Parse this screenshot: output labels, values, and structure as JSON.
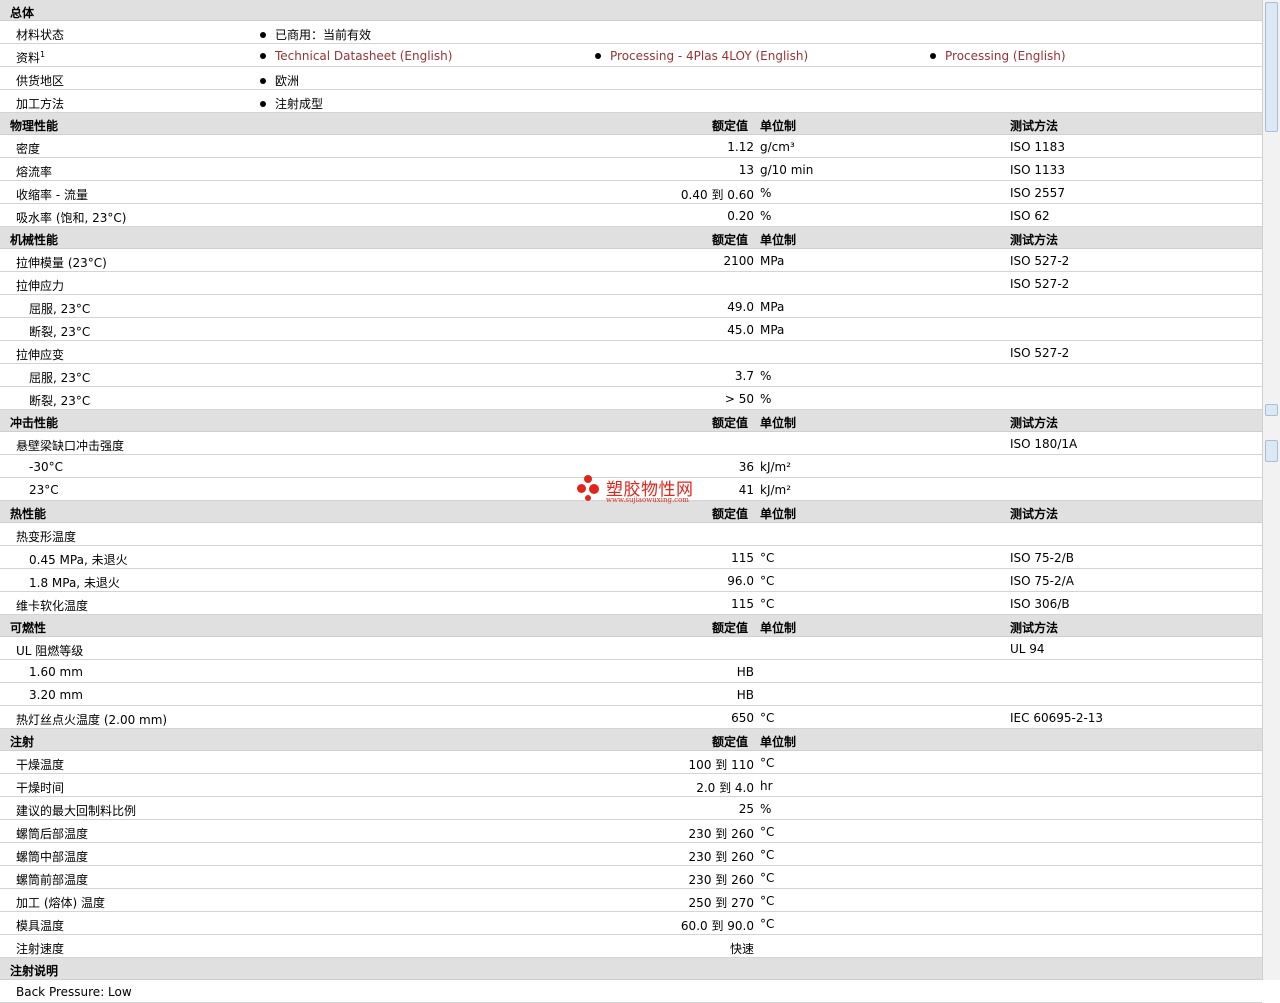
{
  "general": {
    "title": "总体",
    "status_label": "材料状态",
    "status_value": "已商用：当前有效",
    "docs_label": "资料",
    "docs_sup": "1",
    "docs": [
      "Technical Datasheet (English)",
      "Processing - 4Plas 4LOY (English)",
      "Processing (English)"
    ],
    "region_label": "供货地区",
    "region_value": "欧洲",
    "process_label": "加工方法",
    "process_value": "注射成型"
  },
  "headers": {
    "value": "额定值",
    "unit": "单位制",
    "method": "测试方法"
  },
  "physical": {
    "title": "物理性能",
    "rows": [
      {
        "label": "密度",
        "value": "1.12",
        "unit": "g/cm³",
        "method": "ISO 1183"
      },
      {
        "label": "熔流率",
        "value": "13",
        "unit": "g/10 min",
        "method": "ISO 1133"
      },
      {
        "label": "收缩率 - 流量",
        "value": "0.40 到 0.60",
        "unit": "%",
        "method": "ISO 2557"
      },
      {
        "label": "吸水率 (饱和, 23°C)",
        "value": "0.20",
        "unit": "%",
        "method": "ISO 62"
      }
    ]
  },
  "mechanical": {
    "title": "机械性能",
    "rows": [
      {
        "label": "拉伸模量 (23°C)",
        "value": "2100",
        "unit": "MPa",
        "method": "ISO 527-2"
      },
      {
        "label": "拉伸应力",
        "value": "",
        "unit": "",
        "method": "ISO 527-2"
      },
      {
        "label": "屈服, 23°C",
        "value": "49.0",
        "unit": "MPa",
        "method": ""
      },
      {
        "label": "断裂, 23°C",
        "value": "45.0",
        "unit": "MPa",
        "method": ""
      },
      {
        "label": "拉伸应变",
        "value": "",
        "unit": "",
        "method": "ISO 527-2"
      },
      {
        "label": "屈服, 23°C",
        "value": "3.7",
        "unit": "%",
        "method": ""
      },
      {
        "label": "断裂, 23°C",
        "value": "> 50",
        "unit": "%",
        "method": ""
      }
    ]
  },
  "impact": {
    "title": "冲击性能",
    "rows": [
      {
        "label": "悬壁梁缺口冲击强度",
        "value": "",
        "unit": "",
        "method": "ISO 180/1A"
      },
      {
        "label": "-30°C",
        "value": "36",
        "unit": "kJ/m²",
        "method": ""
      },
      {
        "label": "23°C",
        "value": "41",
        "unit": "kJ/m²",
        "method": ""
      }
    ]
  },
  "thermal": {
    "title": "热性能",
    "rows": [
      {
        "label": "热变形温度",
        "value": "",
        "unit": "",
        "method": ""
      },
      {
        "label": "0.45 MPa, 未退火",
        "value": "115",
        "unit": "°C",
        "method": "ISO 75-2/B"
      },
      {
        "label": "1.8 MPa, 未退火",
        "value": "96.0",
        "unit": "°C",
        "method": "ISO 75-2/A"
      },
      {
        "label": "维卡软化温度",
        "value": "115",
        "unit": "°C",
        "method": "ISO 306/B"
      }
    ]
  },
  "flammability": {
    "title": "可燃性",
    "rows": [
      {
        "label": "UL 阻燃等级",
        "value": "",
        "unit": "",
        "method": "UL 94"
      },
      {
        "label": "1.60 mm",
        "value": "HB",
        "unit": "",
        "method": ""
      },
      {
        "label": "3.20 mm",
        "value": "HB",
        "unit": "",
        "method": ""
      },
      {
        "label": "热灯丝点火温度 (2.00 mm)",
        "value": "650",
        "unit": "°C",
        "method": "IEC 60695-2-13"
      }
    ]
  },
  "injection": {
    "title": "注射",
    "rows": [
      {
        "label": "干燥温度",
        "value": "100 到 110",
        "unit": "°C"
      },
      {
        "label": "干燥时间",
        "value": "2.0 到 4.0",
        "unit": "hr"
      },
      {
        "label": "建议的最大回制料比例",
        "value": "25",
        "unit": "%"
      },
      {
        "label": "螺筒后部温度",
        "value": "230 到 260",
        "unit": "°C"
      },
      {
        "label": "螺筒中部温度",
        "value": "230 到 260",
        "unit": "°C"
      },
      {
        "label": "螺筒前部温度",
        "value": "230 到 260",
        "unit": "°C"
      },
      {
        "label": "加工 (熔体) 温度",
        "value": "250 到 270",
        "unit": "°C"
      },
      {
        "label": "模具温度",
        "value": "60.0 到 90.0",
        "unit": "°C"
      },
      {
        "label": "注射速度",
        "value": "快速",
        "unit": ""
      }
    ]
  },
  "notes": {
    "title": "注射说明",
    "text": "Back Pressure: Low"
  },
  "watermark": {
    "name": "塑胶物性网",
    "url": "www.sujiaowuxing.com"
  }
}
